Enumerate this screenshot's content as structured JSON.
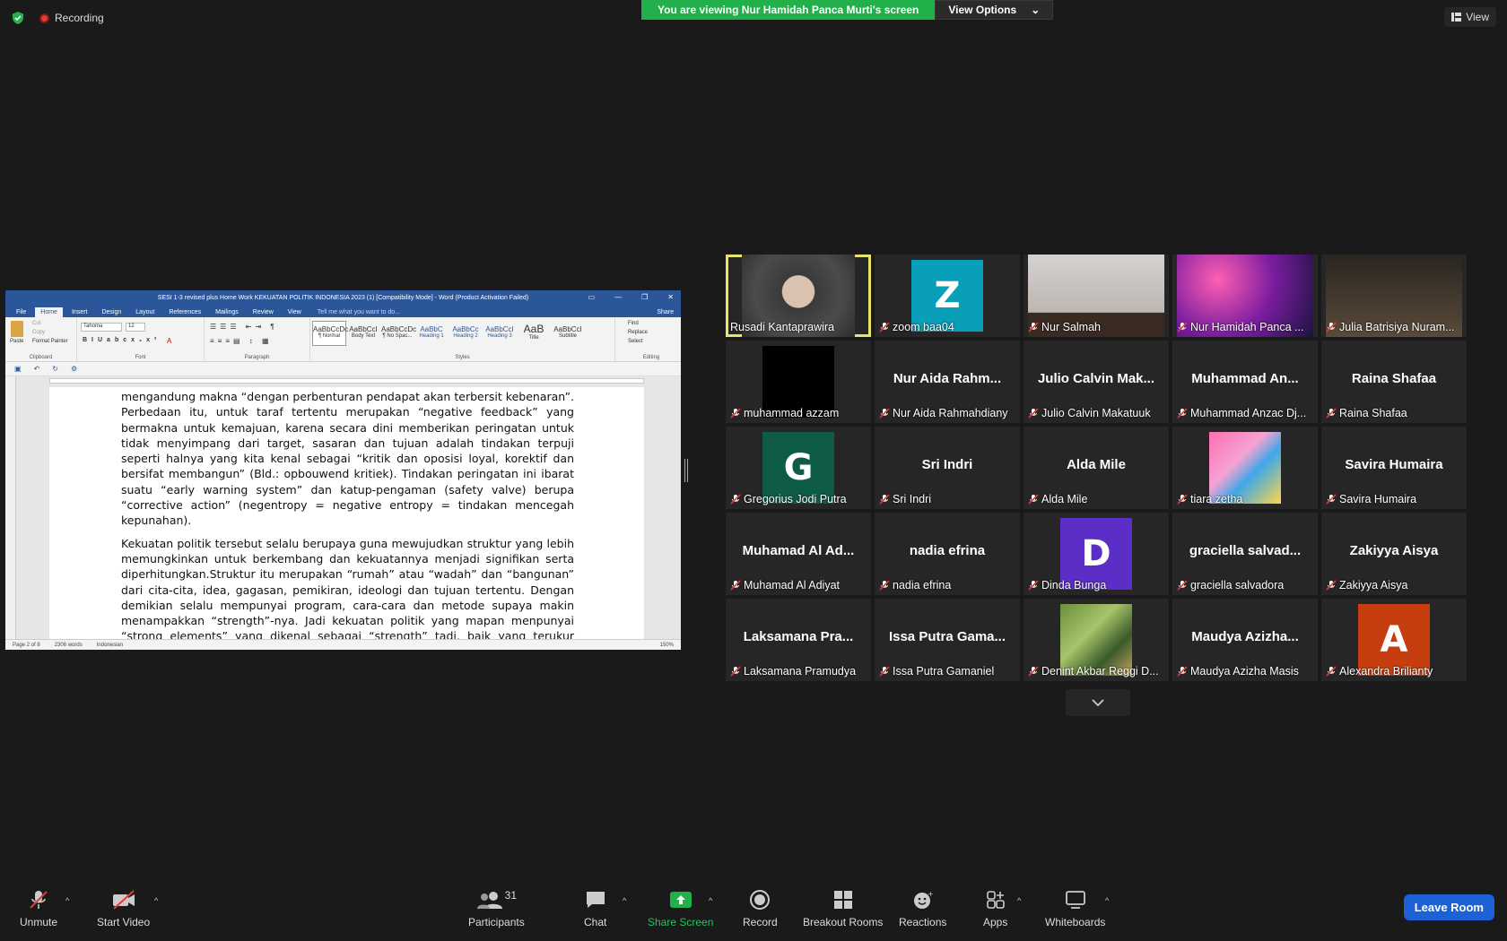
{
  "topbar": {
    "recording_label": "Recording",
    "viewing_banner": "You are viewing Nur Hamidah Panca Murti's screen",
    "view_options": "View Options",
    "view_label": "View"
  },
  "word": {
    "title": "SESI 1-3 revised plus Home Work  KEKUATAN POLITIK INDONESIA 2023 (1) [Compatibility Mode] - Word (Product Activation Failed)",
    "tabs": [
      "File",
      "Home",
      "Insert",
      "Design",
      "Layout",
      "References",
      "Mailings",
      "Review",
      "View"
    ],
    "tell_me": "Tell me what you want to do...",
    "share": "Share",
    "font_name": "Tahoma",
    "font_size": "12",
    "clipboard": {
      "paste": "Paste",
      "cut": "Cut",
      "copy": "Copy",
      "format_painter": "Format Painter",
      "label": "Clipboard"
    },
    "group_labels": {
      "font": "Font",
      "paragraph": "Paragraph",
      "styles": "Styles",
      "editing": "Editing"
    },
    "styles": [
      {
        "preview": "AaBbCcDc",
        "name": "¶ Normal"
      },
      {
        "preview": "AaBbCcI",
        "name": "Body Text"
      },
      {
        "preview": "AaBbCcDc",
        "name": "¶ No Spac..."
      },
      {
        "preview": "AaBbC",
        "name": "Heading 1"
      },
      {
        "preview": "AaBbCc",
        "name": "Heading 2"
      },
      {
        "preview": "AaBbCcI",
        "name": "Heading 3"
      },
      {
        "preview": "AaB",
        "name": "Title"
      },
      {
        "preview": "AaBbCcI",
        "name": "Subtitle"
      }
    ],
    "editing": {
      "find": "Find",
      "replace": "Replace",
      "select": "Select"
    },
    "paragraph1": "mengandung makna “dengan perbenturan pendapat akan terbersit kebenaran”. Perbedaan itu, untuk taraf tertentu merupakan “negative feedback” yang bermakna untuk kemajuan, karena secara dini memberikan peringatan untuk tidak menyimpang dari target, sasaran dan tujuan adalah tindakan terpuji seperti halnya yang kita kenal sebagai “kritik dan oposisi loyal, korektif dan bersifat membangun” (Bld.: opbouwend kritiek). Tindakan peringatan ini ibarat suatu “early warning system” dan katup-pengaman (safety valve) berupa “corrective action” (negentropy = negative entropy = tindakan mencegah kepunahan).",
    "paragraph2": "Kekuatan politik tersebut selalu berupaya guna mewujudkan struktur yang lebih memungkinkan untuk berkembang dan kekuatannya menjadi signifikan serta diperhitungkan.Struktur itu merupakan “rumah” atau “wadah” dan “bangunan” dari cita-cita, idea, gagasan, pemikiran, ideologi dan tujuan tertentu. Dengan demikian selalu mempunyai program, cara-cara dan metode supaya makin menampakkan “strength”-nya. Jadi kekuatan politik yang mapan menpunyai “strong elements” yang dikenal sebagai “strength” tadi, baik yang terukur (measurable) maupun yang takbisa diukur (unmeasurable) yang masih imaginer misalnya",
    "status_page": "Page 2 of 8",
    "status_words": "2306 words",
    "status_lang": "Indonesian",
    "status_zoom": "150%"
  },
  "participants": [
    {
      "name": "Rusadi Kantaprawira",
      "type": "video",
      "active": true,
      "muted": false
    },
    {
      "name": "zoom baa04",
      "type": "avatar",
      "letter": "Z",
      "color": "#0a9fb8",
      "muted": true
    },
    {
      "name": "Nur Salmah",
      "type": "video",
      "muted": true
    },
    {
      "name": "Nur Hamidah Panca ...",
      "type": "video",
      "muted": true
    },
    {
      "name": "Julia Batrisiya Nuram...",
      "type": "video",
      "muted": true
    },
    {
      "name": "muhammad azzam",
      "type": "black",
      "muted": true
    },
    {
      "name": "Nur Aida Rahmahdiany",
      "display": "Nur Aida Rahm...",
      "type": "name",
      "muted": true
    },
    {
      "name": "Julio Calvin Makatuuk",
      "display": "Julio Calvin Mak...",
      "type": "name",
      "muted": true
    },
    {
      "name": "Muhammad Anzac Dj...",
      "display": "Muhammad An...",
      "type": "name",
      "muted": true
    },
    {
      "name": "Raina Shafaa",
      "display": "Raina Shafaa",
      "type": "name",
      "muted": true
    },
    {
      "name": "Gregorius Jodi Putra",
      "type": "avatar",
      "letter": "G",
      "color": "#0e5c48",
      "muted": true
    },
    {
      "name": "Sri Indri",
      "display": "Sri Indri",
      "type": "name",
      "muted": true
    },
    {
      "name": "Alda Mile",
      "display": "Alda Mile",
      "type": "name",
      "muted": true
    },
    {
      "name": "tiara zetha",
      "type": "pic",
      "muted": true
    },
    {
      "name": "Savira Humaira",
      "display": "Savira Humaira",
      "type": "name",
      "muted": true
    },
    {
      "name": "Muhamad Al Adiyat",
      "display": "Muhamad Al Ad...",
      "type": "name",
      "muted": true
    },
    {
      "name": "nadia efrina",
      "display": "nadia efrina",
      "type": "name",
      "muted": true
    },
    {
      "name": "Dinda Bunga",
      "type": "avatar",
      "letter": "D",
      "color": "#5b2fc7",
      "muted": true
    },
    {
      "name": "graciella salvadora",
      "display": "graciella salvad...",
      "type": "name",
      "muted": true
    },
    {
      "name": "Zakiyya Aisya",
      "display": "Zakiyya Aisya",
      "type": "name",
      "muted": true
    },
    {
      "name": "Laksamana Pramudya",
      "display": "Laksamana Pra...",
      "type": "name",
      "muted": true
    },
    {
      "name": "Issa Putra Gamaniel",
      "display": "Issa Putra Gama...",
      "type": "name",
      "muted": true
    },
    {
      "name": "Denint Akbar Reggi D...",
      "type": "pic2",
      "muted": true
    },
    {
      "name": "Maudya Azizha Masis",
      "display": "Maudya Azizha...",
      "type": "name",
      "muted": true
    },
    {
      "name": "Alexandra Brilianty",
      "type": "avatar",
      "letter": "A",
      "color": "#c63d0f",
      "muted": true
    }
  ],
  "toolbar": {
    "unmute": "Unmute",
    "start_video": "Start Video",
    "participants": "Participants",
    "participants_count": "31",
    "chat": "Chat",
    "share_screen": "Share Screen",
    "record": "Record",
    "breakout_rooms": "Breakout Rooms",
    "reactions": "Reactions",
    "apps": "Apps",
    "whiteboards": "Whiteboards",
    "leave_room": "Leave Room"
  },
  "colors": {
    "share_green": "#22b04b",
    "active_speaker": "#e8e46b",
    "leave": "#1c62d6",
    "word_blue": "#2b579a"
  }
}
